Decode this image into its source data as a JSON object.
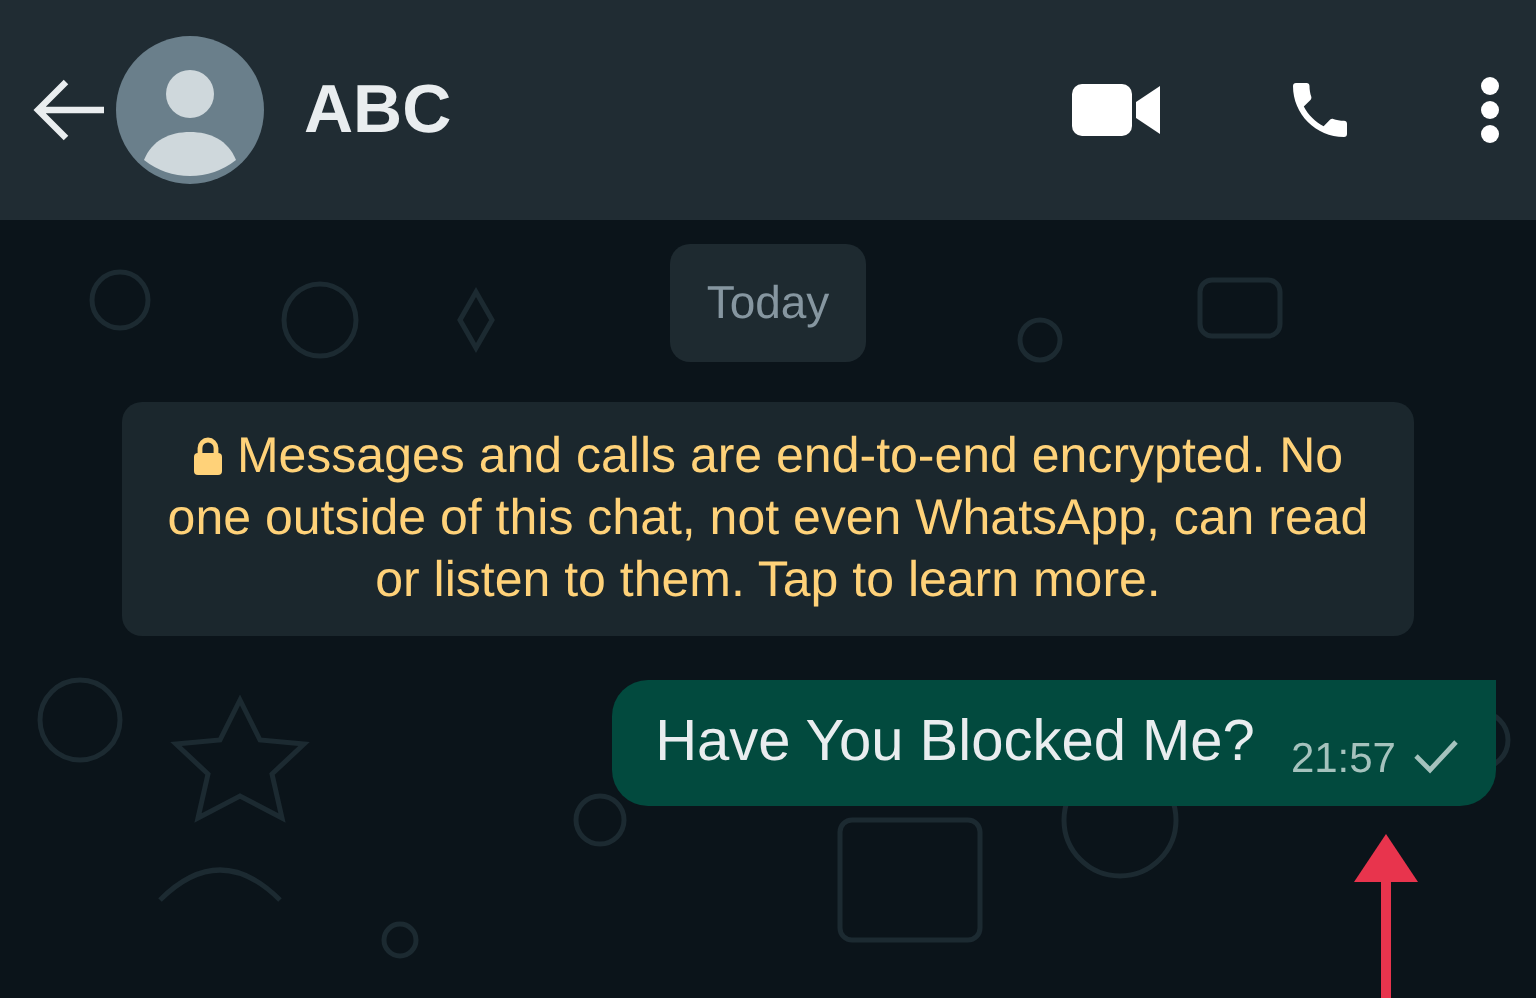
{
  "header": {
    "title": "ABC"
  },
  "date_chip": "Today",
  "encryption_notice": "Messages and calls are end-to-end encrypted. No one outside of this chat, not even WhatsApp, can read or listen to them. Tap to learn more.",
  "messages": [
    {
      "text": "Have You Blocked Me?",
      "time": "21:57",
      "delivered": false
    }
  ]
}
